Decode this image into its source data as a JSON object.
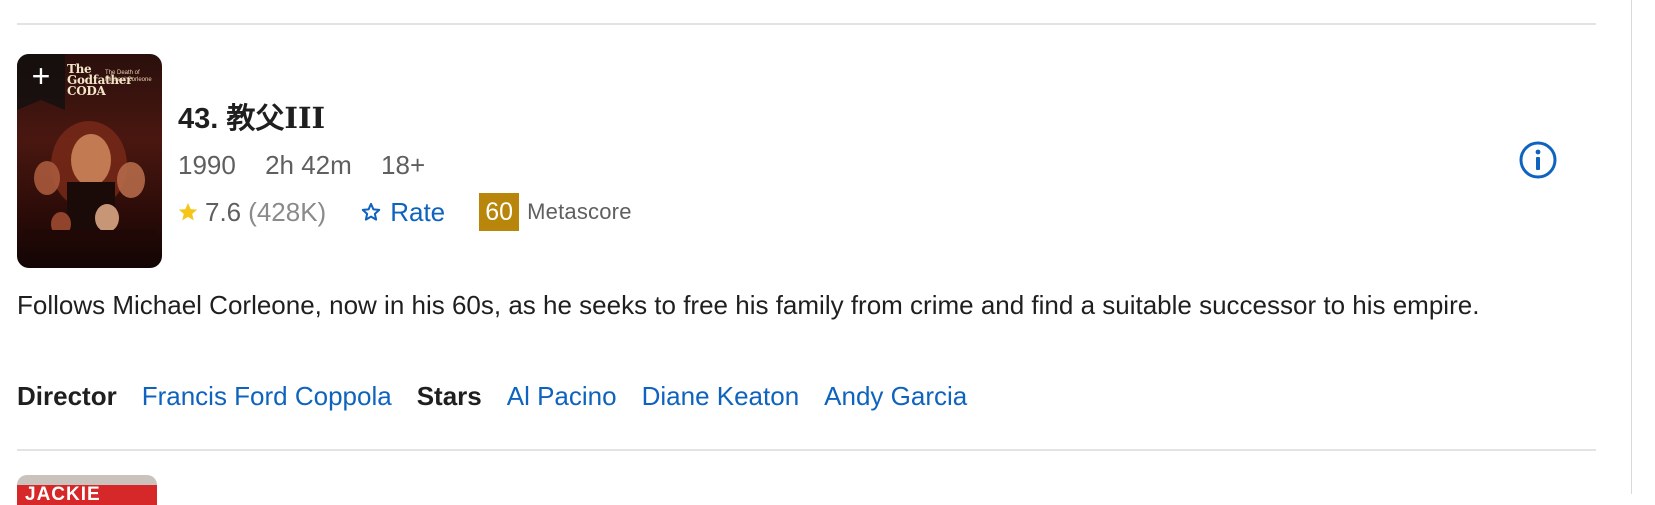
{
  "movie": {
    "rank": "43.",
    "title": "教父III",
    "year": "1990",
    "runtime": "2h 42m",
    "certificate": "18+",
    "rating": "7.6",
    "votes": "(428K)",
    "rate_label": "Rate",
    "metascore": "60",
    "metascore_label": "Metascore",
    "plot": "Follows Michael Corleone, now in his 60s, as he seeks to free his family from crime and find a suitable successor to his empire.",
    "director_label": "Director",
    "director": "Francis Ford Coppola",
    "stars_label": "Stars",
    "stars": [
      "Al Pacino",
      "Diane Keaton",
      "Andy Garcia"
    ],
    "poster": {
      "add_icon": "plus-icon",
      "title_text": "The Godfather CODA",
      "subtitle_text": "The Death of Michael Corleone"
    }
  },
  "next_item": {
    "poster_text": "JACKIE"
  },
  "icons": {
    "star": "star-icon",
    "rate": "star-outline-icon",
    "info": "info-icon"
  },
  "colors": {
    "link": "#0e63be",
    "star": "#f5c518",
    "metascore": "#b8860b"
  }
}
